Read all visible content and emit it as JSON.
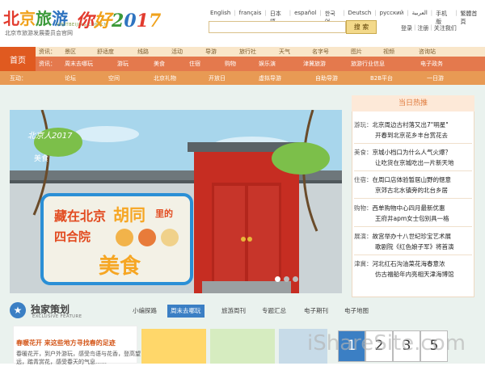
{
  "header": {
    "logo_main": "北京旅游",
    "logo_url": "VISITBEIJING.COM.CN",
    "logo_sub": "北京市旅游发展委员会官网",
    "slogan": "你好2017",
    "languages": [
      "English",
      "français",
      "日本語",
      "español",
      "한국어",
      "Deutsch",
      "русский",
      "العربية",
      "手机版",
      "繁體首頁"
    ],
    "search_button": "搜 索",
    "account": [
      "登录",
      "注册",
      "关注我们"
    ]
  },
  "nav": {
    "home": "首页",
    "top_row_label": "资讯：",
    "top_row": [
      "景区",
      "舒适度",
      "线路",
      "活动",
      "导游",
      "旅行社",
      "天气",
      "名字号",
      "图片",
      "视频",
      "咨询站"
    ],
    "main_row_label": "资讯：",
    "main_row": [
      "周末去哪玩",
      "游玩",
      "美食",
      "住宿",
      "购物",
      "娱乐演",
      "津冀旅游",
      "旅游行业信息",
      "电子政务"
    ],
    "interact_label": "互动：",
    "interact_row": [
      "论坛",
      "空间",
      "北京礼物",
      "开放日",
      "虚拟导游",
      "自助导游",
      "B2B平台",
      "一日游"
    ]
  },
  "banner": {
    "label": "北京人2017",
    "category": "美食",
    "headline_a": "藏在北京",
    "headline_b": "胡同",
    "headline_c": "里的",
    "headline_d": "四合院",
    "headline_e": "美食"
  },
  "hot": {
    "title": "当日热推",
    "items": [
      {
        "cat": "游玩：",
        "l1": "北京周边古村落又出7\"明星\"",
        "l2": "开春到北京花乡丰台赏花去"
      },
      {
        "cat": "美食：",
        "l1": "京城小档口为什么人气火爆？",
        "l2": "让吃货在京城吃出一片新天地"
      },
      {
        "cat": "住宿：",
        "l1": "在周口店体验暂居山野的惬意",
        "l2": "京郊古北水镇旁的北台乡居"
      },
      {
        "cat": "购物：",
        "l1": "西单购物中心四月最新优惠",
        "l2": "王府井apm女士包别具一格"
      },
      {
        "cat": "展演：",
        "l1": "故宫举办十八世纪珍宝艺术展",
        "l2": "歌剧院《红色娘子军》将首演"
      },
      {
        "cat": "津冀：",
        "l1": "河北红石沟油菜花海春意浓",
        "l2": "仿古福船年内亮相天津海博馆"
      }
    ]
  },
  "exclusive": {
    "title": "独家策划",
    "subtitle": "EXCLUSIVE FEATURE",
    "tabs": [
      "小编探路",
      "周末去哪玩",
      "旅游周刊",
      "专题汇总",
      "电子期刊",
      "电子地图"
    ],
    "active_tab": "周末去哪玩"
  },
  "feature": {
    "title": "春暖花开 来这些地方寻找春的足迹",
    "line1": "春暖花开，到户外游玩，感受鸟语与花香，登高望",
    "line2": "远，踏青赏花，感受春天的气息……"
  },
  "pager": [
    "1",
    "2",
    "3",
    "5"
  ],
  "watermark": "iShareSite.com"
}
